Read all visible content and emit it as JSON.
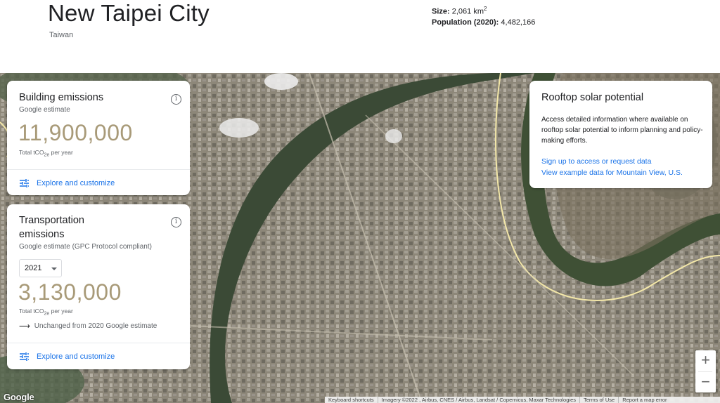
{
  "header": {
    "city": "New Taipei City",
    "country": "Taiwan",
    "size_label": "Size:",
    "size_value": "2,061 km",
    "size_sup": "2",
    "population_label": "Population (2020):",
    "population_value": "4,482,166"
  },
  "building": {
    "title": "Building emissions",
    "subtitle": "Google estimate",
    "value": "11,900,000",
    "unit_pre": "Total tCO",
    "unit_sub": "2e",
    "unit_post": " per year",
    "explore": "Explore and customize"
  },
  "transport": {
    "title": "Transportation emissions",
    "subtitle": "Google estimate (GPC Protocol compliant)",
    "year": "2021",
    "value": "3,130,000",
    "unit_pre": "Total tCO",
    "unit_sub": "2e",
    "unit_post": " per year",
    "change": "Unchanged from 2020 Google estimate",
    "explore": "Explore and customize"
  },
  "solar": {
    "title": "Rooftop solar potential",
    "body": "Access detailed information where available on rooftop solar potential to inform planning and policy-making efforts.",
    "link1": "Sign up to access or request data",
    "link2": "View example data for Mountain View, U.S."
  },
  "map": {
    "logo": "Google",
    "zoom_in": "+",
    "zoom_out": "−",
    "shortcuts": "Keyboard shortcuts",
    "imagery": "Imagery ©2022 , Airbus, CNES / Airbus, Landsat / Copernicus, Maxar Technologies",
    "terms": "Terms of Use",
    "report": "Report a map error"
  },
  "colors": {
    "accent": "#1a73e8",
    "value": "#a89a78",
    "boundary": "#f3e7a8"
  },
  "icons": [
    "info-icon",
    "tune-icon",
    "arrow-right-icon",
    "chevron-down-icon"
  ]
}
